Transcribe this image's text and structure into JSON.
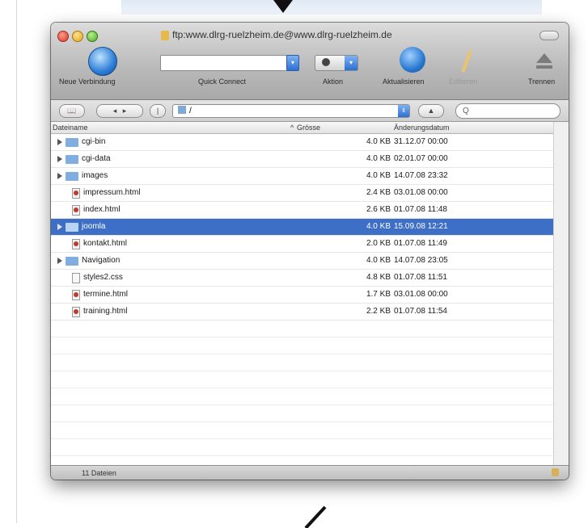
{
  "window": {
    "title": "ftp:www.dlrg-ruelzheim.de@www.dlrg-ruelzheim.de"
  },
  "toolbar": {
    "new_connection": "Neue Verbindung",
    "quick_connect": "Quick Connect",
    "action": "Aktion",
    "refresh": "Aktualisieren",
    "edit": "Editieren",
    "disconnect": "Trennen"
  },
  "pathbar": {
    "path": "/",
    "search_placeholder": "Q"
  },
  "columns": {
    "name": "Dateiname",
    "size": "Grösse",
    "date": "Änderungsdatum"
  },
  "files": [
    {
      "name": "cgi-bin",
      "type": "folder",
      "size": "4.0 KB",
      "date": "31.12.07 00:00"
    },
    {
      "name": "cgi-data",
      "type": "folder",
      "size": "4.0 KB",
      "date": "02.01.07 00:00"
    },
    {
      "name": "images",
      "type": "folder",
      "size": "4.0 KB",
      "date": "14.07.08 23:32"
    },
    {
      "name": "impressum.html",
      "type": "html",
      "size": "2.4 KB",
      "date": "03.01.08 00:00"
    },
    {
      "name": "index.html",
      "type": "html",
      "size": "2.6 KB",
      "date": "01.07.08 11:48"
    },
    {
      "name": "joomla",
      "type": "folder",
      "size": "4.0 KB",
      "date": "15.09.08 12:21",
      "selected": true
    },
    {
      "name": "kontakt.html",
      "type": "html",
      "size": "2.0 KB",
      "date": "01.07.08 11:49"
    },
    {
      "name": "Navigation",
      "type": "folder",
      "size": "4.0 KB",
      "date": "14.07.08 23:05"
    },
    {
      "name": "styles2.css",
      "type": "css",
      "size": "4.8 KB",
      "date": "01.07.08 11:51"
    },
    {
      "name": "termine.html",
      "type": "html",
      "size": "1.7 KB",
      "date": "03.01.08 00:00"
    },
    {
      "name": "training.html",
      "type": "html",
      "size": "2.2 KB",
      "date": "01.07.08 11:54"
    }
  ],
  "status": {
    "count": "11 Dateien"
  },
  "colors": {
    "selection": "#3d6fc6",
    "folder": "#80aee0"
  }
}
